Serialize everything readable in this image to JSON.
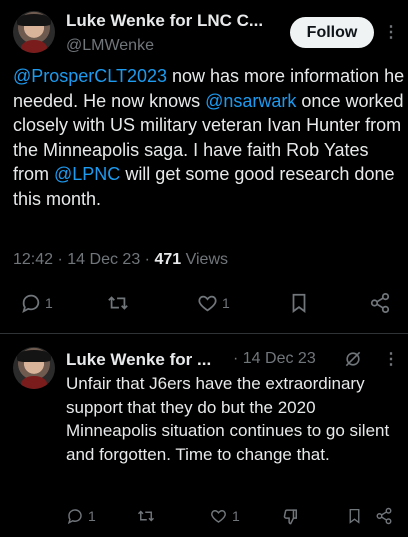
{
  "main_tweet": {
    "author_name": "Luke Wenke for LNC C...",
    "author_handle": "@LMWenke",
    "follow_label": "Follow",
    "more_label": "⋮",
    "text": {
      "mention1": "@ProsperCLT2023",
      "part1": " now has more information he needed.  He now knows ",
      "mention2": "@nsarwark",
      "part2": " once worked closely with US military veteran Ivan Hunter from the Minneapolis saga.  I have faith Rob Yates from ",
      "mention3": "@LPNC",
      "part3": " will get some good research done this month."
    },
    "time": "12:42",
    "date": "14 Dec 23",
    "views_count": "471",
    "views_label": "Views",
    "replies_count": "1",
    "retweets_count": "",
    "likes_count": "1"
  },
  "reply_tweet": {
    "author_name": "Luke Wenke for ...",
    "date": "14 Dec 23",
    "text": "Unfair that J6ers have the extraordinary support that they do but the 2020 Minneapolis situation continues to go silent and forgotten. Time to change that.",
    "replies_count": "1",
    "likes_count": "1"
  },
  "colors": {
    "background": "#000000",
    "text": "#e7e9ea",
    "muted": "#71767b",
    "link": "#1d9bf0",
    "divider": "#2f3336"
  },
  "icons": [
    "reply-icon",
    "retweet-icon",
    "like-icon",
    "bookmark-icon",
    "share-icon",
    "grok-icon",
    "dislike-icon"
  ]
}
